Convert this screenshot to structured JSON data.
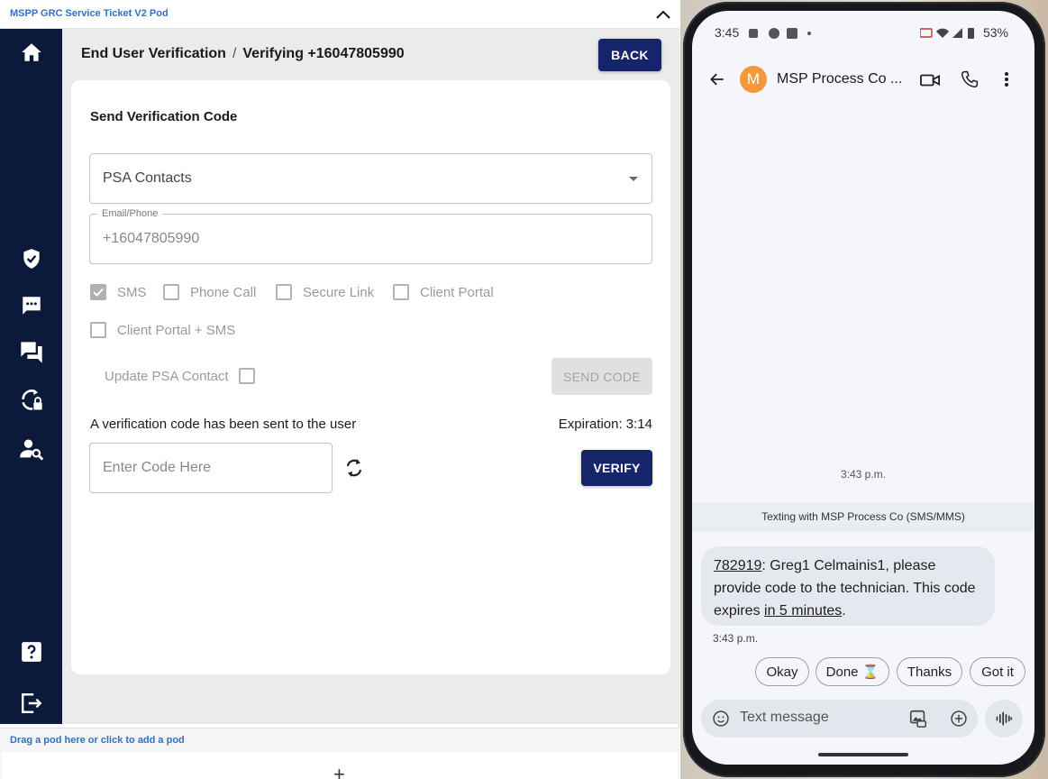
{
  "pod": {
    "title": "MSPP GRC Service Ticket V2 Pod",
    "add_pod_label": "Drag a pod here or click to add a pod",
    "add_pod_plus": "+"
  },
  "sidebar": {
    "icons": [
      "home-icon",
      "shield-check-icon",
      "chat-icon",
      "forum-icon",
      "lock-reset-icon",
      "user-search-icon",
      "help-icon",
      "logout-icon"
    ]
  },
  "header": {
    "crumb1": "End User Verification",
    "separator": "/",
    "crumb2": "Verifying +16047805990",
    "back_label": "BACK"
  },
  "card": {
    "title": "Send Verification Code",
    "contact_source": "PSA Contacts",
    "email_phone_label": "Email/Phone",
    "email_phone_value": "+16047805990",
    "methods": [
      {
        "label": "SMS",
        "checked": true
      },
      {
        "label": "Phone Call",
        "checked": false
      },
      {
        "label": "Secure Link",
        "checked": false
      },
      {
        "label": "Client Portal",
        "checked": false
      },
      {
        "label": "Client Portal + SMS",
        "checked": false
      }
    ],
    "update_psa_label": "Update PSA Contact",
    "send_code_label": "SEND CODE",
    "sent_message": "A verification code has been sent to the user",
    "expiration": "Expiration: 3:14",
    "code_placeholder": "Enter Code Here",
    "verify_label": "VERIFY"
  },
  "phone": {
    "status_time": "3:45",
    "status_battery": "53%",
    "contact_initial": "M",
    "contact_name": "MSP Process Co ...",
    "timestamp_1": "3:43 p.m.",
    "texting_with": "Texting with MSP Process Co (SMS/MMS)",
    "message": {
      "code": "782919",
      "part1": ": Greg1 Celmainis1, please provide code to the technician. This code expires ",
      "link": "in 5 minutes",
      "part2": "."
    },
    "timestamp_2": "3:43 p.m.",
    "quick_replies": [
      "Okay",
      "Done ⌛",
      "Thanks",
      "Got it"
    ],
    "compose_placeholder": "Text message"
  },
  "colors": {
    "sidebar_bg": "#0b1a3a",
    "primary_button": "#16246b",
    "pod_title": "#2f72c4",
    "avatar": "#f29a3a"
  }
}
